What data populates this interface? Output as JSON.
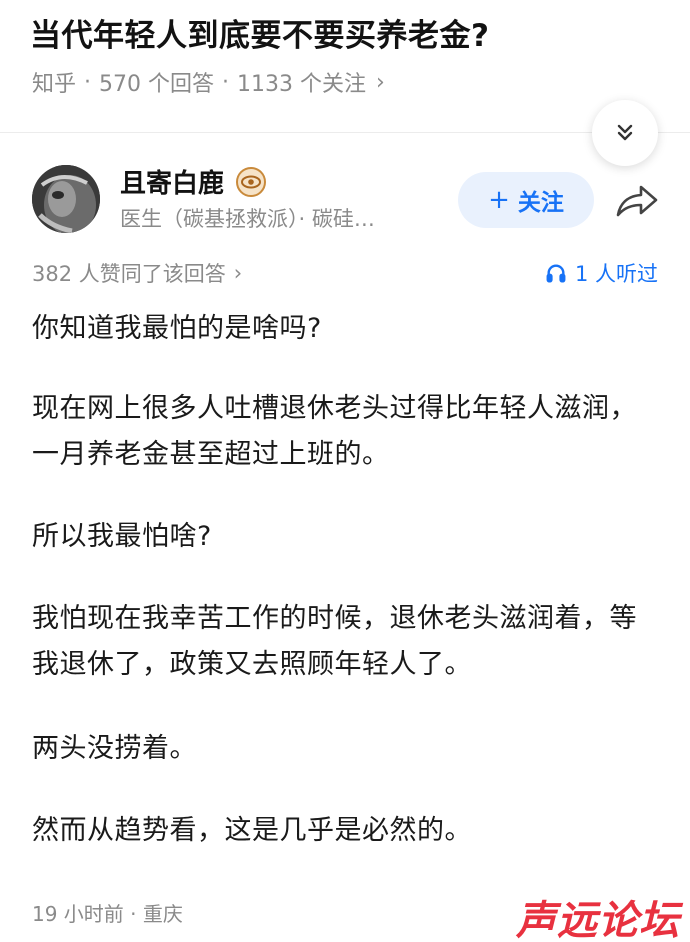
{
  "question": {
    "title": "当代年轻人到底要不要买养老金?",
    "source": "知乎",
    "answers": "570 个回答",
    "followers": "1133 个关注"
  },
  "author": {
    "name": "且寄白鹿",
    "bio": "医生（碳基拯救派）· 碳硅…",
    "follow_label": "关注"
  },
  "answer": {
    "votes": "382 人赞同了该回答",
    "listeners": "1 人听过",
    "paragraphs": [
      "你知道我最怕的是啥吗?",
      "现在网上很多人吐槽退休老头过得比年轻人滋润，一月养老金甚至超过上班的。",
      "所以我最怕啥?",
      "我怕现在我幸苦工作的时候，退休老头滋润着，等我退休了，政策又去照顾年轻人了。",
      "两头没捞着。",
      "然而从趋势看，这是几乎是必然的。"
    ],
    "time_location": "19 小时前 · 重庆"
  },
  "watermark": "声远论坛",
  "colors": {
    "accent": "#1772f6",
    "follow_bg": "#e9f1fd",
    "meta_gray": "#8a8a8a",
    "watermark_red": "#e8313f"
  }
}
